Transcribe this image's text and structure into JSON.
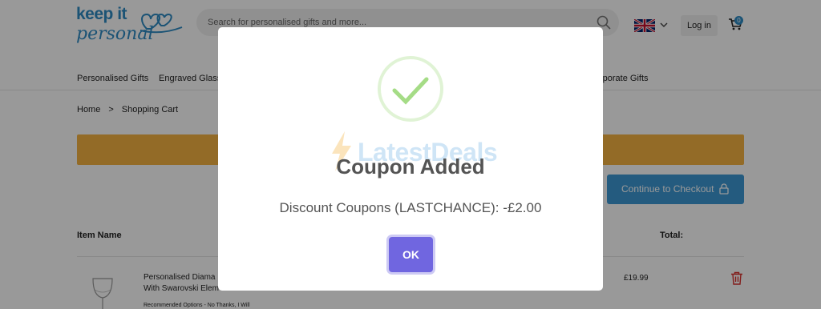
{
  "brand": {
    "line1": "keep it",
    "line2": "personal"
  },
  "header": {
    "search_placeholder": "Search for personalised gifts and more...",
    "login_label": "Log in",
    "cart_count": "0"
  },
  "nav": {
    "items": [
      {
        "label": "Personalised Gifts"
      },
      {
        "label": "Engraved Glass"
      },
      {
        "label": "rporate Gifts"
      }
    ]
  },
  "breadcrumb": {
    "home": "Home",
    "separator": ">",
    "current": "Shopping Cart"
  },
  "cart": {
    "checkout_label": "Continue to Checkout",
    "col_item": "Item Name",
    "col_total": "Total:",
    "item": {
      "name": "Personalised Diama With Swarovski Elem",
      "option": "Recommended Options - No Thanks, I Will",
      "price": "£19.99"
    }
  },
  "modal": {
    "watermark": "LatestDeals",
    "title": "Coupon Added",
    "message": "Discount Coupons (LASTCHANCE): -£2.00",
    "ok_label": "OK"
  },
  "colors": {
    "accent": "#7066e0",
    "success": "#a5dc86",
    "banner": "#f5b342",
    "checkout": "#3d98d4",
    "brand": "#2d8ac4"
  }
}
